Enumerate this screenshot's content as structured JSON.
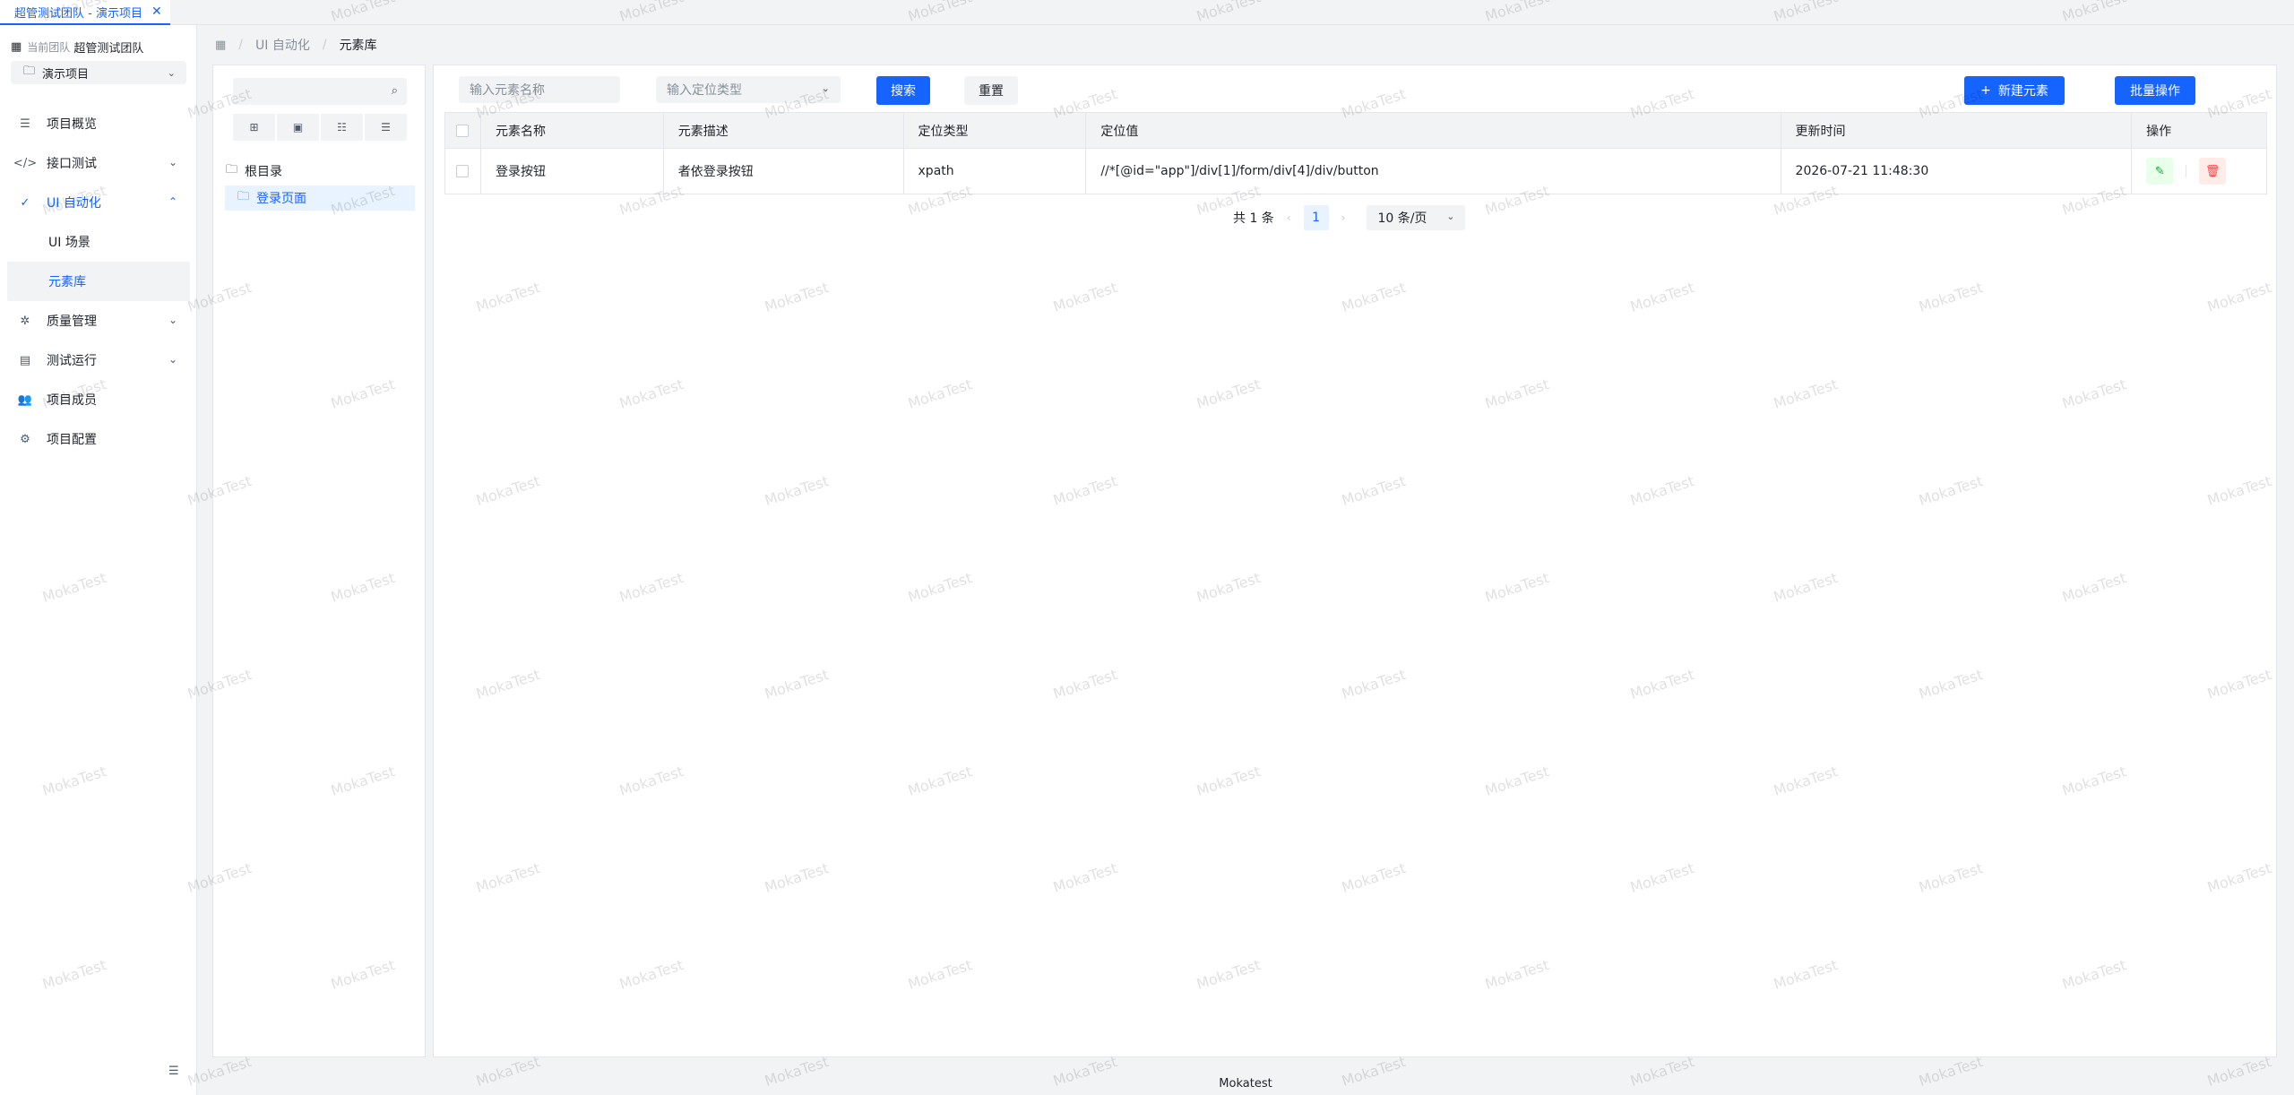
{
  "tab": {
    "title": "超管测试团队 - 演示项目",
    "close": "✕"
  },
  "sidebar": {
    "team_label": "当前团队",
    "team_name": "超管测试团队",
    "project": "演示项目",
    "menu": [
      {
        "label": "项目概览",
        "icon": "list-icon"
      },
      {
        "label": "接口测试",
        "icon": "code-icon"
      },
      {
        "label": "UI 自动化",
        "icon": "check-circle-icon"
      },
      {
        "label": "质量管理",
        "icon": "bug-icon"
      },
      {
        "label": "测试运行",
        "icon": "calendar-icon"
      },
      {
        "label": "项目成员",
        "icon": "users-icon"
      },
      {
        "label": "项目配置",
        "icon": "gear-icon"
      }
    ],
    "ui_sub": [
      {
        "label": "UI 场景"
      },
      {
        "label": "元素库"
      }
    ]
  },
  "breadcrumb": {
    "level1": "UI 自动化",
    "current": "元素库"
  },
  "tree": {
    "root": "根目录",
    "child": "登录页面"
  },
  "toolbar": {
    "name_placeholder": "输入元素名称",
    "type_placeholder": "输入定位类型",
    "search": "搜索",
    "reset": "重置",
    "new_element": "新建元素",
    "batch": "批量操作"
  },
  "table": {
    "headers": [
      "元素名称",
      "元素描述",
      "定位类型",
      "定位值",
      "更新时间",
      "操作"
    ],
    "rows": [
      {
        "name": "登录按钮",
        "desc": "者依登录按钮",
        "type": "xpath",
        "value": "//*[@id=\"app\"]/div[1]/form/div[4]/div/button",
        "updated": "2026-07-21 11:48:30"
      }
    ]
  },
  "pager": {
    "total": "共 1 条",
    "page": "1",
    "size": "10 条/页"
  },
  "footer": "Mokatest",
  "watermark": "MokaTest",
  "colors": {
    "primary": "#1664ff",
    "success": "#00b42a",
    "danger": "#f53f3f"
  }
}
